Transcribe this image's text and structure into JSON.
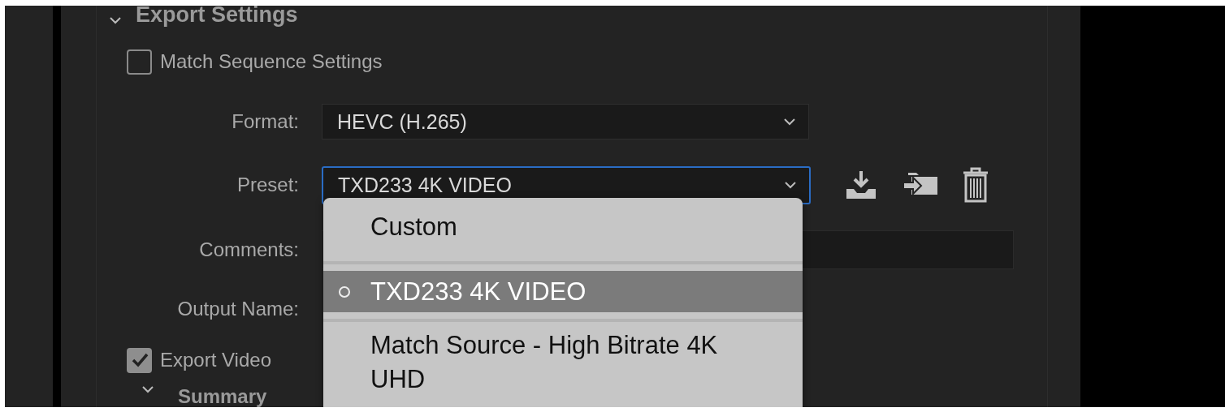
{
  "section": {
    "title": "Export Settings"
  },
  "match_sequence": {
    "label": "Match Sequence Settings",
    "checked": false
  },
  "format": {
    "label": "Format:",
    "value": "HEVC (H.265)"
  },
  "preset": {
    "label": "Preset:",
    "value": "TXD233 4K VIDEO",
    "open": true
  },
  "comments": {
    "label": "Comments:"
  },
  "output_name": {
    "label": "Output Name:"
  },
  "export_video": {
    "label": "Export Video",
    "checked": true
  },
  "summary": {
    "title": "Summary"
  },
  "preset_menu": [
    {
      "label": "Custom",
      "selected": false
    },
    {
      "label": "TXD233 4K VIDEO",
      "selected": true
    },
    {
      "label": "Match Source - High Bitrate 4K UHD",
      "selected": false
    }
  ]
}
